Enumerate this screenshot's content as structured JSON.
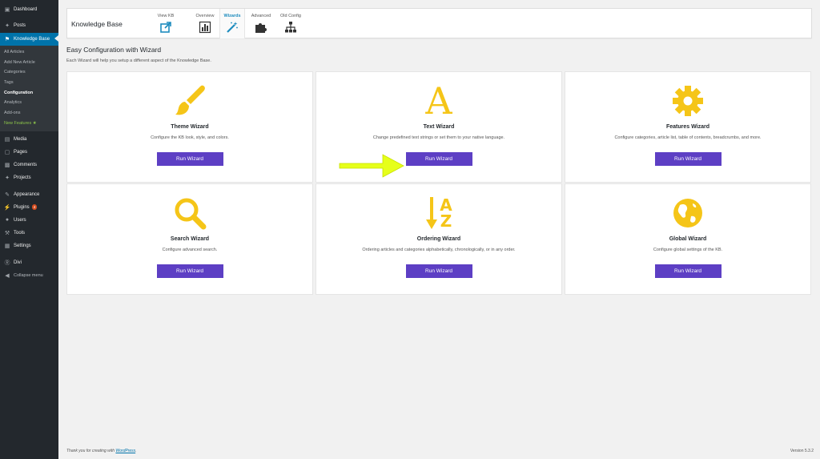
{
  "sidebar": {
    "dashboard": "Dashboard",
    "posts": "Posts",
    "knowledge_base": "Knowledge Base",
    "kb_submenu": [
      "All Articles",
      "Add New Article",
      "Categories",
      "Tags",
      "Configuration",
      "Analytics",
      "Add-ons",
      "New Features ★"
    ],
    "media": "Media",
    "pages": "Pages",
    "comments": "Comments",
    "projects": "Projects",
    "appearance": "Appearance",
    "plugins": "Plugins",
    "plugins_badge": "4",
    "users": "Users",
    "tools": "Tools",
    "settings": "Settings",
    "divi": "Divi",
    "collapse": "Collapse menu"
  },
  "header": {
    "title": "Knowledge Base",
    "tabs": [
      {
        "label": "View KB",
        "icon": "external-link-icon"
      },
      {
        "label": "Overview",
        "icon": "bar-chart-icon"
      },
      {
        "label": "Wizards",
        "icon": "magic-wand-icon"
      },
      {
        "label": "Advanced",
        "icon": "puzzle-icon"
      },
      {
        "label": "Old Config",
        "icon": "sitemap-icon"
      }
    ]
  },
  "main": {
    "title": "Easy Configuration with Wizard",
    "description": "Each Wizard will help you setup a different aspect of the Knowledge Base.",
    "wizards": [
      {
        "title": "Theme Wizard",
        "desc": "Configure the KB look, style, and colors.",
        "button": "Run Wizard",
        "icon": "paint-brush-icon"
      },
      {
        "title": "Text Wizard",
        "desc": "Change predefined text strings or set them to your native language.",
        "button": "Run Wizard",
        "icon": "font-icon",
        "glyph": "A"
      },
      {
        "title": "Features Wizard",
        "desc": "Configure categories, article list, table of contents, breadcrumbs, and more.",
        "button": "Run Wizard",
        "icon": "gear-icon"
      },
      {
        "title": "Search Wizard",
        "desc": "Configure advanced search.",
        "button": "Run Wizard",
        "icon": "search-icon"
      },
      {
        "title": "Ordering Wizard",
        "desc": "Ordering articles and categories alphabetically, chronologically, or in any order.",
        "button": "Run Wizard",
        "icon": "sort-alpha-icon",
        "glyph_top": "A",
        "glyph_bottom": "Z"
      },
      {
        "title": "Global Wizard",
        "desc": "Configure global settings of the KB.",
        "button": "Run Wizard",
        "icon": "globe-icon"
      }
    ]
  },
  "footer": {
    "thanks_prefix": "Thank you for creating with ",
    "thanks_link": "WordPress",
    "thanks_suffix": ".",
    "version": "Version 5.3.2"
  },
  "colors": {
    "sidebar_bg": "#23282d",
    "active_blue": "#0073aa",
    "icon_yellow": "#f5c518",
    "button_purple": "#5d3fc4",
    "arrow_yellow": "#e6ff1a"
  }
}
